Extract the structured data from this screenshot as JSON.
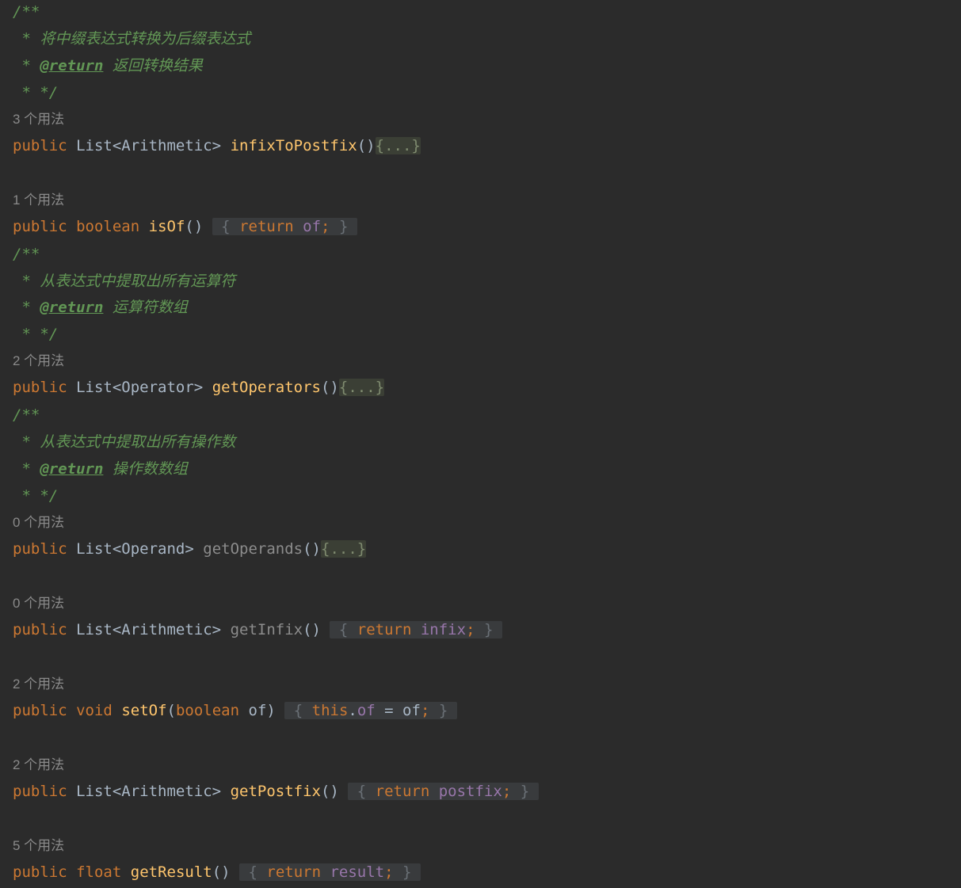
{
  "code": {
    "doc1": {
      "open": "/**",
      "desc": "将中缀表达式转换为后缀表达式",
      "tag": "@return",
      "tag_desc": "返回转换结果",
      "close": "* */"
    },
    "m1": {
      "usage": "3 个用法",
      "mod": "public",
      "type": "List<Arithmetic>",
      "name": "infixToPostfix",
      "parens": "()",
      "fold": "{...}"
    },
    "m2": {
      "usage": "1 个用法",
      "mod": "public",
      "type": "boolean",
      "name": "isOf",
      "parens": "()",
      "ret": "return",
      "field": "of",
      "semi": ";"
    },
    "doc2": {
      "open": "/**",
      "desc": "从表达式中提取出所有运算符",
      "tag": "@return",
      "tag_desc": "运算符数组",
      "close": "* */"
    },
    "m3": {
      "usage": "2 个用法",
      "mod": "public",
      "type": "List<Operator>",
      "name": "getOperators",
      "parens": "()",
      "fold": "{...}"
    },
    "doc3": {
      "open": "/**",
      "desc": "从表达式中提取出所有操作数",
      "tag": "@return",
      "tag_desc": "操作数数组",
      "close": "* */"
    },
    "m4": {
      "usage": "0 个用法",
      "mod": "public",
      "type": "List<Operand>",
      "name": "getOperands",
      "parens": "()",
      "fold": "{...}"
    },
    "m5": {
      "usage": "0 个用法",
      "mod": "public",
      "type": "List<Arithmetic>",
      "name": "getInfix",
      "parens": "()",
      "ret": "return",
      "field": "infix",
      "semi": ";"
    },
    "m6": {
      "usage": "2 个用法",
      "mod": "public",
      "type": "void",
      "name": "setOf",
      "param_type": "boolean",
      "param": "of",
      "this_kw": "this",
      "field": "of",
      "assign": " = of",
      "semi": ";"
    },
    "m7": {
      "usage": "2 个用法",
      "mod": "public",
      "type": "List<Arithmetic>",
      "name": "getPostfix",
      "parens": "()",
      "ret": "return",
      "field": "postfix",
      "semi": ";"
    },
    "m8": {
      "usage": "5 个用法",
      "mod": "public",
      "type": "float",
      "name": "getResult",
      "parens": "()",
      "ret": "return",
      "field": "result",
      "semi": ";"
    }
  }
}
